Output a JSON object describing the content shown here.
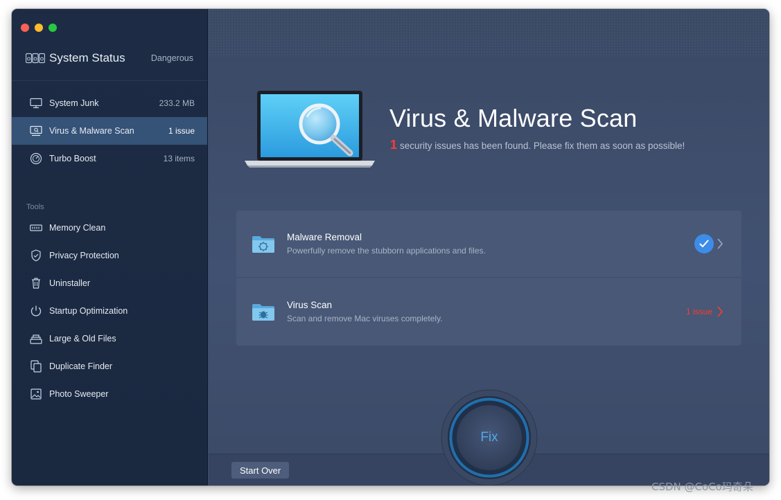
{
  "window": {
    "traffic_lights": [
      "close",
      "minimize",
      "zoom"
    ]
  },
  "sidebar": {
    "status": {
      "icon": "system-status-icon",
      "title": "System Status",
      "value": "Dangerous"
    },
    "items": [
      {
        "name": "system-junk",
        "icon": "monitor-icon",
        "label": "System Junk",
        "value": "233.2 MB",
        "active": false
      },
      {
        "name": "virus-malware-scan",
        "icon": "scan-monitor-icon",
        "label": "Virus & Malware Scan",
        "value": "1 issue",
        "active": true
      },
      {
        "name": "turbo-boost",
        "icon": "gauge-icon",
        "label": "Turbo Boost",
        "value": "13 items",
        "active": false
      }
    ],
    "tools_heading": "Tools",
    "tools": [
      {
        "name": "memory-clean",
        "icon": "memory-chip-icon",
        "label": "Memory Clean"
      },
      {
        "name": "privacy-protection",
        "icon": "shield-icon",
        "label": "Privacy Protection"
      },
      {
        "name": "uninstaller",
        "icon": "trash-icon",
        "label": "Uninstaller"
      },
      {
        "name": "startup-optimization",
        "icon": "power-icon",
        "label": "Startup Optimization"
      },
      {
        "name": "large-old-files",
        "icon": "file-stack-icon",
        "label": "Large & Old Files"
      },
      {
        "name": "duplicate-finder",
        "icon": "duplicate-icon",
        "label": "Duplicate Finder"
      },
      {
        "name": "photo-sweeper",
        "icon": "photo-icon",
        "label": "Photo Sweeper"
      }
    ]
  },
  "main": {
    "hero": {
      "icon": "laptop-magnifier-illustration",
      "title": "Virus & Malware Scan",
      "issue_count": "1",
      "subtitle": "security issues has been found. Please fix them as soon as possible!"
    },
    "rows": [
      {
        "name": "malware-removal",
        "icon": "folder-virus-icon",
        "title": "Malware Removal",
        "desc": "Powerfully remove the stubborn applications and files.",
        "status": "ok",
        "issue_label": ""
      },
      {
        "name": "virus-scan",
        "icon": "folder-bug-icon",
        "title": "Virus Scan",
        "desc": "Scan and remove Mac viruses completely.",
        "status": "issue",
        "issue_label": "1 issue"
      }
    ],
    "fix_label": "Fix",
    "start_over_label": "Start Over"
  },
  "watermark": "CSDN @CoCo玛奇朵",
  "colors": {
    "accent_blue": "#3d8ce8",
    "danger_red": "#ff3b30",
    "sidebar_bg": "#1d2c44",
    "sidebar_active": "#355277",
    "main_bg": "#3f4e6b"
  }
}
